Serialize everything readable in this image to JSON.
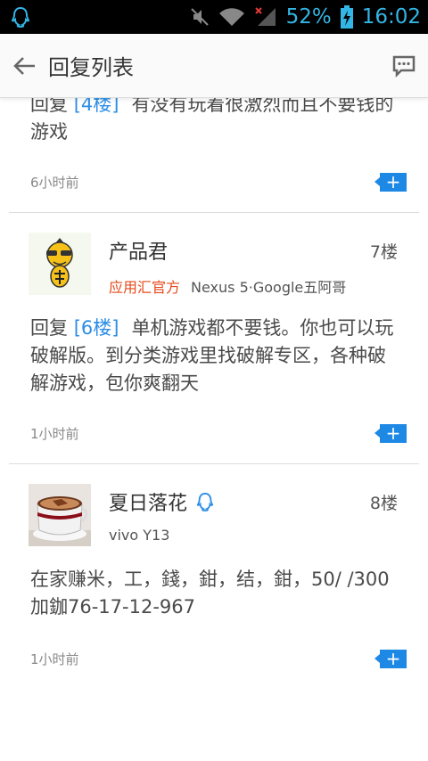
{
  "status_bar": {
    "battery": "52%",
    "time": "16:02",
    "icons": [
      "qq-icon",
      "mute-icon",
      "wifi-icon",
      "signal-off-icon",
      "battery-charging-icon"
    ],
    "accent": "#33b5e5"
  },
  "app_bar": {
    "title": "回复列表",
    "icons": [
      "back-arrow-icon",
      "comment-icon"
    ]
  },
  "items": [
    {
      "reply_prefix": "回复",
      "reply_floor": "[4楼]",
      "text": "有没有玩着很激烈而且不要钱的游戏",
      "time": "6小时前"
    }
  ],
  "posts": [
    {
      "user": "产品君",
      "floor": "7楼",
      "official_label": "应用汇官方",
      "device": "Nexus 5·Google五阿哥",
      "reply_prefix": "回复",
      "reply_floor": "[6楼]",
      "text": "单机游戏都不要钱。你也可以玩破解版。到分类游戏里找破解专区，各种破解游戏，包你爽翻天",
      "time": "1小时前"
    },
    {
      "user": "夏日落花",
      "floor": "8楼",
      "device": "vivo Y13",
      "text": "在家赚米，工，錢，鉗，结，鉗，50/ /300加鉫76-17-12-967",
      "time": "1小时前"
    }
  ],
  "colors": {
    "link": "#2c8ee5",
    "official": "#e64a19",
    "action": "#1e88e5"
  }
}
